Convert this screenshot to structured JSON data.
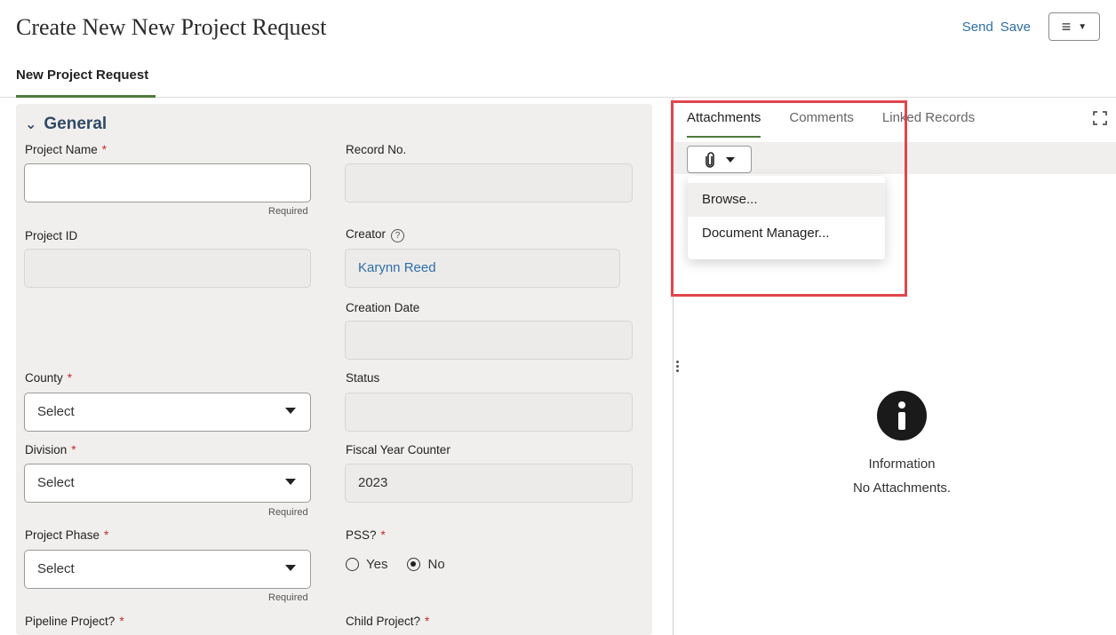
{
  "header": {
    "title": "Create New New Project Request",
    "send_label": "Send",
    "save_label": "Save",
    "menu_icon": "hamburger-menu-icon"
  },
  "page_tabs": [
    {
      "label": "New Project Request",
      "active": true
    }
  ],
  "form": {
    "section_title": "General",
    "project_name": {
      "label": "Project Name",
      "required_mark": "*",
      "value": "",
      "hint": "Required"
    },
    "record_no": {
      "label": "Record No.",
      "value": ""
    },
    "project_id": {
      "label": "Project ID",
      "value": ""
    },
    "creator": {
      "label": "Creator",
      "help_glyph": "?",
      "value": "Karynn Reed"
    },
    "creation_date": {
      "label": "Creation Date",
      "value": ""
    },
    "county": {
      "label": "County",
      "required_mark": "*",
      "value": "Select"
    },
    "status": {
      "label": "Status",
      "value": ""
    },
    "division": {
      "label": "Division",
      "required_mark": "*",
      "value": "Select",
      "hint": "Required"
    },
    "fiscal_year_counter": {
      "label": "Fiscal Year Counter",
      "value": "2023"
    },
    "project_phase": {
      "label": "Project Phase",
      "required_mark": "*",
      "value": "Select",
      "hint": "Required"
    },
    "pss": {
      "label": "PSS?",
      "required_mark": "*",
      "options": [
        "Yes",
        "No"
      ],
      "selected": "No"
    },
    "pipeline_project": {
      "label": "Pipeline Project?",
      "required_mark": "*"
    },
    "child_project": {
      "label": "Child Project?",
      "required_mark": "*"
    }
  },
  "side_panel": {
    "tabs": [
      {
        "label": "Attachments",
        "active": true
      },
      {
        "label": "Comments",
        "active": false
      },
      {
        "label": "Linked Records",
        "active": false
      }
    ],
    "attach_menu": [
      "Browse...",
      "Document Manager..."
    ],
    "empty_state": {
      "title": "Information",
      "message": "No Attachments."
    }
  },
  "colors": {
    "accent_link": "#2e6fa7",
    "tab_underline": "#4f7a3c",
    "required": "#c62a2a",
    "highlight_box": "#e0464c",
    "panel_bg": "#f1efed"
  }
}
